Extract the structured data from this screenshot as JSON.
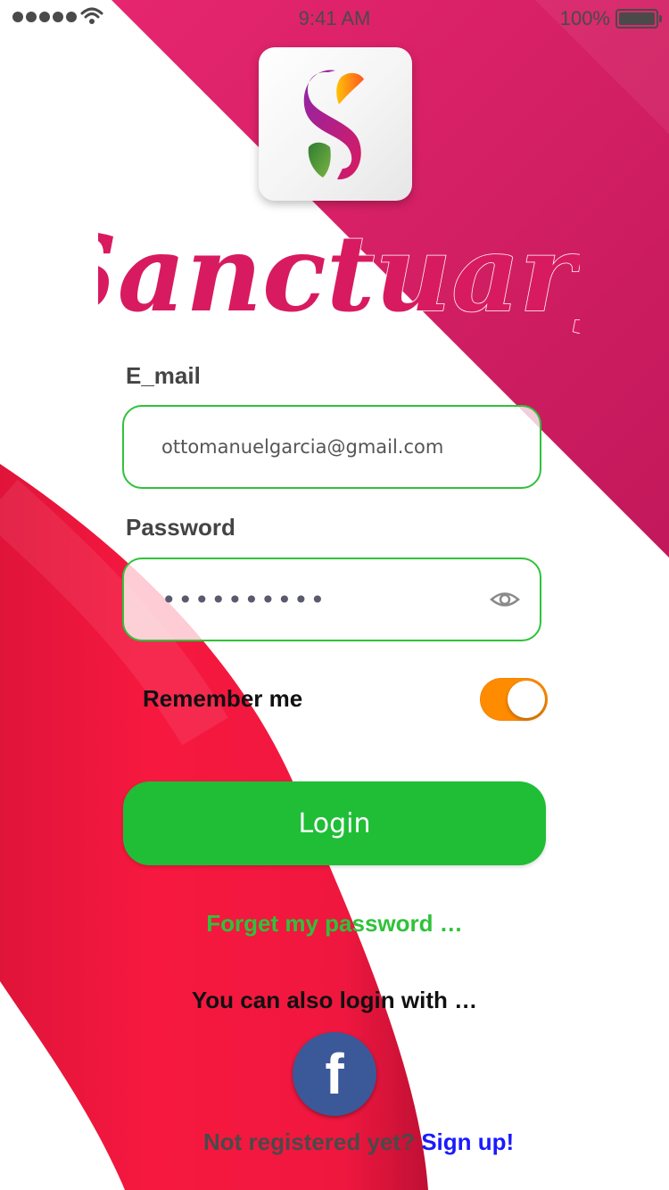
{
  "status_bar": {
    "time": "9:41 AM",
    "battery": "100%",
    "icons": [
      "signal-dots-icon",
      "wifi-icon",
      "battery-icon"
    ]
  },
  "brand": {
    "logo_icon": "sanctuary-s-logo-icon",
    "name": "Sanctuary"
  },
  "form": {
    "email_label": "E_mail",
    "email_value": "ottomanuelgarcia@gmail.com",
    "password_label": "Password",
    "password_value": "••••••••••",
    "password_toggle_icon": "eye-icon",
    "remember_label": "Remember me",
    "remember_on": true,
    "login_label": "Login",
    "forgot_label": "Forget my password …"
  },
  "social": {
    "prompt": "You can also login with …",
    "facebook_glyph": "f",
    "facebook_icon": "facebook-icon"
  },
  "footer": {
    "not_registered": "Not registered yet?",
    "signup_link": "Sign up!"
  },
  "colors": {
    "brand_pink": "#d81b60",
    "accent_green": "#1fbe36",
    "toggle_orange": "#ff8c00",
    "facebook_blue": "#3b5998",
    "link_blue": "#1a1aff",
    "ribbon_red": "#f0173f"
  }
}
